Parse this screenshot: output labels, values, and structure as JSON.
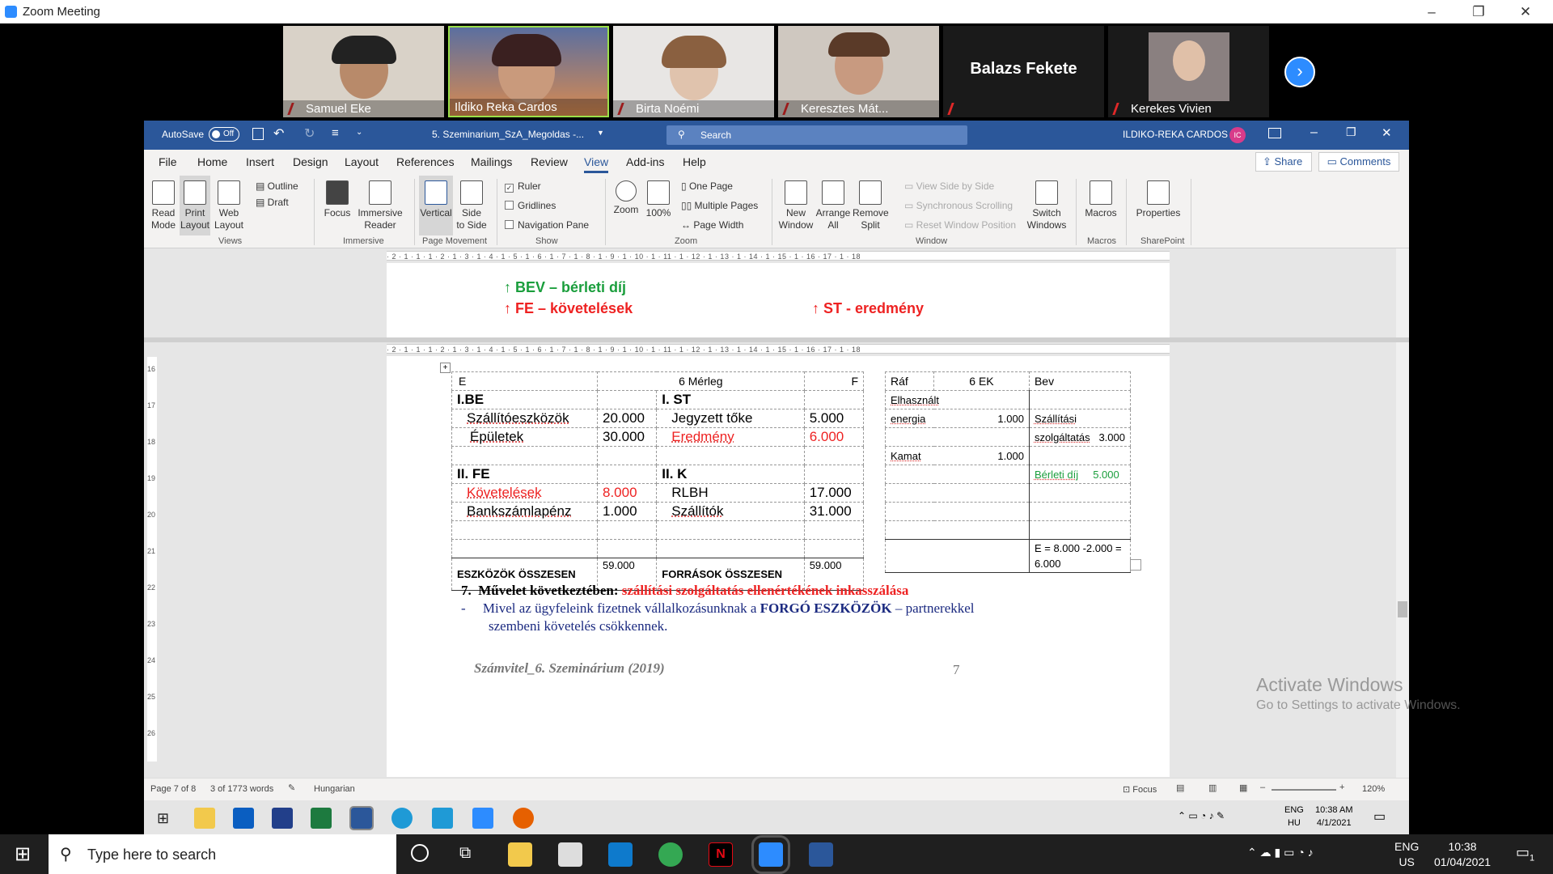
{
  "zoom": {
    "title": "Zoom Meeting",
    "participants": [
      "Samuel Eke",
      "Ildiko Reka Cardos",
      "Birta Noémi",
      "Keresztes Mát...",
      "Balazs Fekete",
      "Kerekes Vivien"
    ]
  },
  "word": {
    "autosave_label": "AutoSave",
    "autosave_state": "Off",
    "filename": "5. Szeminarium_SzA_Megoldas -...",
    "search_placeholder": "Search",
    "user": "ILDIKO-REKA CARDOS",
    "user_initials": "IC",
    "tabs": [
      "File",
      "Home",
      "Insert",
      "Design",
      "Layout",
      "References",
      "Mailings",
      "Review",
      "View",
      "Add-ins",
      "Help"
    ],
    "active_tab": "View",
    "share": "Share",
    "comments": "Comments",
    "ribbon": {
      "views": [
        "Read\nMode",
        "Print\nLayout",
        "Web\nLayout"
      ],
      "outline": "Outline",
      "draft": "Draft",
      "focus": "Focus",
      "immersive_reader": "Immersive\nReader",
      "vertical": "Vertical",
      "side_to_side": "Side\nto Side",
      "ruler": "Ruler",
      "gridlines": "Gridlines",
      "navigation_pane": "Navigation Pane",
      "zoom": "Zoom",
      "zoom100": "100%",
      "one_page": "One Page",
      "multiple_pages": "Multiple Pages",
      "page_width": "Page Width",
      "new_window": "New\nWindow",
      "arrange_all": "Arrange\nAll",
      "remove_split": "Remove\nSplit",
      "view_side_by_side": "View Side by Side",
      "synchronous_scrolling": "Synchronous Scrolling",
      "reset_window_position": "Reset Window Position",
      "switch_windows": "Switch\nWindows",
      "macros": "Macros",
      "properties": "Properties",
      "groups": [
        "Views",
        "Immersive",
        "Page Movement",
        "Show",
        "Zoom",
        "Window",
        "Macros",
        "SharePoint"
      ]
    },
    "ruler_text": "· 2 · 1 · 1 · 1 · 2 · 1 · 3 · 1 · 4 · 1 · 5 · 1 · 6 · 1 · 7 · 1 · 8 · 1 · 9 · 1 · 10 · 1 · 11 · 1 · 12 · 1 · 13 · 1 · 14 · 1 · 15 · 1 · 16 · 17 · 1 · 18",
    "vruler": [
      "16",
      "17",
      "18",
      "19",
      "20",
      "21",
      "22",
      "23",
      "24",
      "25",
      "26"
    ],
    "top_pane": {
      "line1": "↑ BEV – bérleti díj",
      "line2": "↑ FE – követelések",
      "line3": "↑ ST - eredmény"
    },
    "balance": {
      "header": [
        "E",
        "6 Mérleg",
        "F"
      ],
      "rows": [
        [
          "I.BE",
          "",
          "I. ST",
          ""
        ],
        [
          "Szállítóeszközök",
          "20.000",
          "Jegyzett tőke",
          "5.000"
        ],
        [
          "Épületek",
          "30.000",
          "Eredmény",
          "6.000"
        ],
        [
          "",
          "",
          "",
          ""
        ],
        [
          "II. FE",
          "",
          "II. K",
          ""
        ],
        [
          "Követelések",
          "8.000",
          "RLBH",
          "17.000"
        ],
        [
          "Bankszámlapénz",
          "1.000",
          "Szállítók",
          "31.000"
        ],
        [
          "",
          "",
          "",
          ""
        ],
        [
          "",
          "",
          "",
          ""
        ]
      ],
      "total_left_label": "ESZKÖZÖK ÖSSZESEN",
      "total_left": "59.000",
      "total_right_label": "FORRÁSOK ÖSSZESEN",
      "total_right": "59.000"
    },
    "ek": {
      "header": [
        "Ráf",
        "6 EK",
        "Bev"
      ],
      "elhasznalt": "Elhasznált",
      "energia": "energia",
      "energia_val": "1.000",
      "szallitasi": "Szállítási",
      "szolgaltatas": "szolgáltatás",
      "szolg_val": "3.000",
      "kamat": "Kamat",
      "kamat_val": "1.000",
      "berleti": "Bérleti díj",
      "berleti_val": "5.000",
      "e_formula": "E = 8.000 -2.000 =",
      "e_result": "6.000"
    },
    "item7_num": "7.",
    "item7_label": "Művelet következtében:",
    "item7_text": "szállítási szolgáltatás ellenértékének inkasszálása",
    "bullet_dash": "-",
    "bullet_text_1a": "Mivel az ügyfeleink fizetnek vállalkozásunknak a",
    "bullet_text_1b": "FORGÓ ESZKÖZÖK",
    "bullet_text_1c": "– partnerekkel",
    "bullet_text_2": "szembeni követelés csökkennek.",
    "footer_left": "Számvitel_6. Szeminárium (2019)",
    "footer_page": "7",
    "status": {
      "page": "Page 7 of 8",
      "words": "3 of 1773 words",
      "language": "Hungarian",
      "focus": "Focus",
      "zoom": "120%"
    },
    "activate_title": "Activate Windows",
    "activate_sub": "Go to Settings to activate Windows."
  },
  "inner_tray": {
    "lang1": "ENG",
    "lang2": "HU",
    "time": "10:38 AM",
    "date": "4/1/2021"
  },
  "taskbar": {
    "search_placeholder": "Type here to search",
    "lang1": "ENG",
    "lang2": "US",
    "time": "10:38",
    "date": "01/04/2021",
    "notif": "1"
  },
  "colors": {
    "word_blue": "#2b579a",
    "red": "#e22222",
    "green": "#1a9e3c",
    "navy": "#1b2a80"
  }
}
